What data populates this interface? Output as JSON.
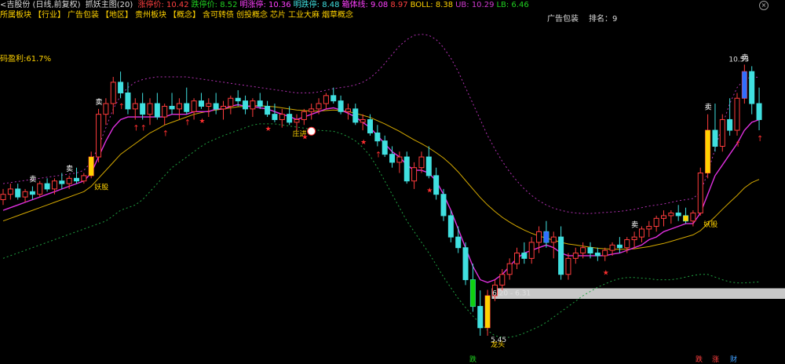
{
  "header": {
    "title": "<吉股份 (日线,前复权)",
    "indicator": "抓妖主图(20)",
    "items": [
      {
        "label": "涨停价: 10.42",
        "color": "#ff4040"
      },
      {
        "label": "跌停价: 8.52",
        "color": "#20d020"
      },
      {
        "label": "明涨停: 10.36",
        "color": "#ff40ff"
      },
      {
        "label": "明跌停: 8.48",
        "color": "#40e0e0"
      },
      {
        "label": "箱体线: 9.08",
        "color": "#ff40ff"
      },
      {
        "label": "8.97",
        "color": "#ff4040"
      },
      {
        "label": "BOLL: 8.38",
        "color": "#ffd200"
      },
      {
        "label": "UB: 10.29",
        "color": "#d03ad0"
      },
      {
        "label": "LB: 6.46",
        "color": "#20d020"
      }
    ]
  },
  "tags": [
    "所属板块",
    "【行业】",
    "广告包装",
    "【地区】",
    "贵州板块",
    "【概念】",
    "含可转债",
    "创投概念",
    "芯片",
    "工业大麻",
    "烟草概念"
  ],
  "ad_label": "广告包装",
  "rank_label": "排名：9",
  "profit_label": "码盈利:61.7%",
  "close_icon": "close-icon",
  "chart_data": {
    "type": "candlestick",
    "candles": [
      [
        8.0,
        8.2,
        7.9,
        8.1
      ],
      [
        8.1,
        8.3,
        8.0,
        8.2
      ],
      [
        8.2,
        8.3,
        8.0,
        8.05
      ],
      [
        8.05,
        8.2,
        7.95,
        8.15
      ],
      [
        8.15,
        8.25,
        8.0,
        8.1
      ],
      [
        8.1,
        8.35,
        8.05,
        8.3
      ],
      [
        8.3,
        8.4,
        8.15,
        8.2
      ],
      [
        8.2,
        8.4,
        8.1,
        8.35
      ],
      [
        8.35,
        8.5,
        8.2,
        8.3
      ],
      [
        8.3,
        8.45,
        8.2,
        8.4
      ],
      [
        8.4,
        8.6,
        8.3,
        8.35
      ],
      [
        8.35,
        8.5,
        8.3,
        8.45
      ],
      [
        8.45,
        8.9,
        8.4,
        8.8
      ],
      [
        8.8,
        9.7,
        8.7,
        9.6
      ],
      [
        9.6,
        9.9,
        9.4,
        9.8
      ],
      [
        9.8,
        10.3,
        9.6,
        10.2
      ],
      [
        10.2,
        10.4,
        9.9,
        10.0
      ],
      [
        10.0,
        10.2,
        9.6,
        9.7
      ],
      [
        9.7,
        9.9,
        9.5,
        9.8
      ],
      [
        9.8,
        10.0,
        9.5,
        9.6
      ],
      [
        9.6,
        9.9,
        9.4,
        9.8
      ],
      [
        9.8,
        10.0,
        9.5,
        9.55
      ],
      [
        9.55,
        9.8,
        9.4,
        9.75
      ],
      [
        9.75,
        10.0,
        9.6,
        9.7
      ],
      [
        9.7,
        9.9,
        9.5,
        9.8
      ],
      [
        9.8,
        10.1,
        9.6,
        9.65
      ],
      [
        9.65,
        9.9,
        9.5,
        9.85
      ],
      [
        9.85,
        10.0,
        9.7,
        9.75
      ],
      [
        9.75,
        9.9,
        9.55,
        9.8
      ],
      [
        9.8,
        10.0,
        9.6,
        9.7
      ],
      [
        9.7,
        9.85,
        9.5,
        9.75
      ],
      [
        9.75,
        9.95,
        9.6,
        9.9
      ],
      [
        9.9,
        10.05,
        9.75,
        9.85
      ],
      [
        9.85,
        9.95,
        9.6,
        9.7
      ],
      [
        9.7,
        9.9,
        9.55,
        9.85
      ],
      [
        9.85,
        10.0,
        9.7,
        9.75
      ],
      [
        9.75,
        9.85,
        9.55,
        9.6
      ],
      [
        9.6,
        9.8,
        9.45,
        9.5
      ],
      [
        9.5,
        9.7,
        9.35,
        9.6
      ],
      [
        9.6,
        9.75,
        9.4,
        9.45
      ],
      [
        9.45,
        9.6,
        9.3,
        9.5
      ],
      [
        9.5,
        9.7,
        9.4,
        9.65
      ],
      [
        9.65,
        9.8,
        9.5,
        9.7
      ],
      [
        9.7,
        9.9,
        9.6,
        9.8
      ],
      [
        9.8,
        10.0,
        9.7,
        9.95
      ],
      [
        9.95,
        10.1,
        9.8,
        9.85
      ],
      [
        9.85,
        9.95,
        9.6,
        9.65
      ],
      [
        9.65,
        9.8,
        9.5,
        9.7
      ],
      [
        9.7,
        9.8,
        9.4,
        9.45
      ],
      [
        9.45,
        9.6,
        9.3,
        9.5
      ],
      [
        9.5,
        9.6,
        9.2,
        9.25
      ],
      [
        9.25,
        9.4,
        9.0,
        9.1
      ],
      [
        9.1,
        9.2,
        8.8,
        8.85
      ],
      [
        8.85,
        9.0,
        8.6,
        8.7
      ],
      [
        8.7,
        8.9,
        8.5,
        8.8
      ],
      [
        8.8,
        8.9,
        8.3,
        8.35
      ],
      [
        8.35,
        8.7,
        8.2,
        8.6
      ],
      [
        8.6,
        8.9,
        8.5,
        8.8
      ],
      [
        8.8,
        9.0,
        8.4,
        8.45
      ],
      [
        8.45,
        8.6,
        8.0,
        8.1
      ],
      [
        8.1,
        8.2,
        7.6,
        7.7
      ],
      [
        7.7,
        7.8,
        7.2,
        7.3
      ],
      [
        7.3,
        7.5,
        7.0,
        7.1
      ],
      [
        7.1,
        7.2,
        6.4,
        6.5
      ],
      [
        6.5,
        6.8,
        5.9,
        6.0
      ],
      [
        6.0,
        6.3,
        5.45,
        5.6
      ],
      [
        5.6,
        6.31,
        5.45,
        6.2
      ],
      [
        6.2,
        6.5,
        6.1,
        6.4
      ],
      [
        6.4,
        6.7,
        6.3,
        6.6
      ],
      [
        6.6,
        6.9,
        6.5,
        6.8
      ],
      [
        6.8,
        7.1,
        6.7,
        7.0
      ],
      [
        7.0,
        7.2,
        6.8,
        6.9
      ],
      [
        6.9,
        7.3,
        6.8,
        7.2
      ],
      [
        7.2,
        7.5,
        7.0,
        7.4
      ],
      [
        7.4,
        7.6,
        7.1,
        7.2
      ],
      [
        7.2,
        7.4,
        6.9,
        7.3
      ],
      [
        7.3,
        7.5,
        6.5,
        6.6
      ],
      [
        6.6,
        7.0,
        6.5,
        6.9
      ],
      [
        6.9,
        7.1,
        6.8,
        7.0
      ],
      [
        7.0,
        7.2,
        6.9,
        7.1
      ],
      [
        7.1,
        7.2,
        6.9,
        7.0
      ],
      [
        7.0,
        7.1,
        6.85,
        6.95
      ],
      [
        6.95,
        7.1,
        6.85,
        7.05
      ],
      [
        7.05,
        7.2,
        6.95,
        7.15
      ],
      [
        7.15,
        7.3,
        7.0,
        7.1
      ],
      [
        7.1,
        7.3,
        7.0,
        7.25
      ],
      [
        7.25,
        7.4,
        7.1,
        7.3
      ],
      [
        7.3,
        7.5,
        7.2,
        7.45
      ],
      [
        7.45,
        7.6,
        7.3,
        7.5
      ],
      [
        7.5,
        7.7,
        7.4,
        7.65
      ],
      [
        7.65,
        7.8,
        7.5,
        7.7
      ],
      [
        7.7,
        7.8,
        7.55,
        7.75
      ],
      [
        7.75,
        7.9,
        7.6,
        7.7
      ],
      [
        7.7,
        7.85,
        7.55,
        7.6
      ],
      [
        7.6,
        7.8,
        7.5,
        7.75
      ],
      [
        7.75,
        8.6,
        7.7,
        8.5
      ],
      [
        8.5,
        9.6,
        8.4,
        9.3
      ],
      [
        9.3,
        9.8,
        8.9,
        9.0
      ],
      [
        9.0,
        9.6,
        8.9,
        9.5
      ],
      [
        9.5,
        9.9,
        9.2,
        9.3
      ],
      [
        9.3,
        10.0,
        9.2,
        9.9
      ],
      [
        9.9,
        10.53,
        9.8,
        10.4
      ],
      [
        10.4,
        10.5,
        9.6,
        9.8
      ],
      [
        9.8,
        10.1,
        9.3,
        9.5
      ]
    ],
    "boll_mid": [
      7.6,
      7.65,
      7.7,
      7.75,
      7.8,
      7.85,
      7.9,
      7.95,
      8.0,
      8.05,
      8.1,
      8.15,
      8.25,
      8.4,
      8.55,
      8.7,
      8.85,
      8.95,
      9.05,
      9.15,
      9.25,
      9.32,
      9.4,
      9.45,
      9.5,
      9.55,
      9.6,
      9.63,
      9.66,
      9.68,
      9.7,
      9.72,
      9.74,
      9.75,
      9.76,
      9.76,
      9.75,
      9.74,
      9.72,
      9.7,
      9.68,
      9.67,
      9.66,
      9.66,
      9.67,
      9.68,
      9.67,
      9.65,
      9.62,
      9.58,
      9.54,
      9.48,
      9.42,
      9.35,
      9.28,
      9.2,
      9.12,
      9.05,
      8.97,
      8.88,
      8.78,
      8.66,
      8.52,
      8.36,
      8.2,
      8.04,
      7.9,
      7.78,
      7.67,
      7.58,
      7.5,
      7.43,
      7.37,
      7.32,
      7.28,
      7.24,
      7.2,
      7.17,
      7.15,
      7.13,
      7.11,
      7.09,
      7.08,
      7.07,
      7.07,
      7.07,
      7.08,
      7.1,
      7.12,
      7.15,
      7.18,
      7.22,
      7.26,
      7.3,
      7.34,
      7.42,
      7.55,
      7.68,
      7.82,
      7.95,
      8.08,
      8.22,
      8.32,
      8.38
    ],
    "support": [
      7.8,
      7.85,
      7.9,
      7.95,
      8.0,
      8.05,
      8.1,
      8.15,
      8.2,
      8.25,
      8.3,
      8.35,
      8.5,
      8.8,
      9.1,
      9.35,
      9.5,
      9.55,
      9.55,
      9.55,
      9.55,
      9.55,
      9.55,
      9.6,
      9.6,
      9.6,
      9.65,
      9.65,
      9.65,
      9.7,
      9.7,
      9.75,
      9.78,
      9.75,
      9.75,
      9.72,
      9.7,
      9.65,
      9.6,
      9.56,
      9.5,
      9.55,
      9.6,
      9.65,
      9.7,
      9.72,
      9.68,
      9.62,
      9.55,
      9.45,
      9.35,
      9.2,
      9.05,
      8.9,
      8.8,
      8.65,
      8.55,
      8.55,
      8.5,
      8.35,
      8.1,
      7.8,
      7.45,
      7.1,
      6.75,
      6.5,
      6.45,
      6.5,
      6.6,
      6.75,
      6.9,
      7.0,
      7.05,
      7.1,
      7.15,
      7.1,
      7.0,
      6.95,
      6.95,
      6.95,
      6.95,
      6.95,
      6.95,
      6.98,
      7.0,
      7.05,
      7.1,
      7.15,
      7.25,
      7.3,
      7.4,
      7.45,
      7.5,
      7.55,
      7.55,
      7.75,
      8.1,
      8.45,
      8.65,
      8.85,
      9.05,
      9.3,
      9.45,
      9.5
    ],
    "ub": [
      8.3,
      8.32,
      8.34,
      8.36,
      8.38,
      8.4,
      8.42,
      8.44,
      8.46,
      8.48,
      8.5,
      8.55,
      8.7,
      9.0,
      9.35,
      9.7,
      9.95,
      10.1,
      10.2,
      10.25,
      10.28,
      10.3,
      10.3,
      10.3,
      10.3,
      10.3,
      10.28,
      10.26,
      10.24,
      10.22,
      10.2,
      10.18,
      10.16,
      10.14,
      10.12,
      10.1,
      10.08,
      10.06,
      10.04,
      10.02,
      10.0,
      10.0,
      10.0,
      10.02,
      10.05,
      10.08,
      10.1,
      10.12,
      10.15,
      10.2,
      10.28,
      10.4,
      10.55,
      10.72,
      10.88,
      11.0,
      11.08,
      11.1,
      11.08,
      11.0,
      10.85,
      10.65,
      10.4,
      10.1,
      9.8,
      9.5,
      9.2,
      8.95,
      8.72,
      8.52,
      8.35,
      8.2,
      8.08,
      7.98,
      7.9,
      7.84,
      7.8,
      7.77,
      7.75,
      7.74,
      7.74,
      7.75,
      7.76,
      7.77,
      7.78,
      7.8,
      7.82,
      7.85,
      7.88,
      7.9,
      7.92,
      7.95,
      7.98,
      8.0,
      8.02,
      8.15,
      8.5,
      8.95,
      9.4,
      9.8,
      10.1,
      10.25,
      10.3,
      10.29
    ],
    "lb": [
      6.9,
      6.95,
      7.0,
      7.05,
      7.1,
      7.15,
      7.2,
      7.25,
      7.3,
      7.35,
      7.4,
      7.45,
      7.5,
      7.55,
      7.6,
      7.7,
      7.8,
      7.85,
      7.9,
      8.0,
      8.15,
      8.3,
      8.45,
      8.6,
      8.7,
      8.8,
      8.9,
      9.0,
      9.08,
      9.14,
      9.2,
      9.25,
      9.3,
      9.35,
      9.4,
      9.42,
      9.42,
      9.42,
      9.4,
      9.38,
      9.36,
      9.34,
      9.32,
      9.3,
      9.29,
      9.28,
      9.24,
      9.18,
      9.1,
      8.98,
      8.82,
      8.6,
      8.35,
      8.1,
      7.85,
      7.6,
      7.4,
      7.2,
      7.0,
      6.78,
      6.55,
      6.35,
      6.15,
      5.98,
      5.82,
      5.68,
      5.55,
      5.45,
      5.42,
      5.42,
      5.45,
      5.5,
      5.56,
      5.62,
      5.7,
      5.8,
      5.9,
      6.0,
      6.1,
      6.2,
      6.28,
      6.36,
      6.42,
      6.48,
      6.52,
      6.54,
      6.54,
      6.53,
      6.52,
      6.5,
      6.5,
      6.5,
      6.52,
      6.55,
      6.58,
      6.6,
      6.6,
      6.55,
      6.5,
      6.46,
      6.44,
      6.44,
      6.45,
      6.46
    ],
    "box_band": [
      6.2,
      6.31
    ],
    "annotations": [
      {
        "text": "卖",
        "i": 13,
        "pos": "above"
      },
      {
        "text": "卖",
        "i": 4,
        "pos": "above"
      },
      {
        "text": "卖",
        "i": 9,
        "pos": "above"
      },
      {
        "text": "卖",
        "i": 86,
        "pos": "above"
      },
      {
        "text": "卖",
        "i": 96,
        "pos": "above"
      },
      {
        "text": "卖",
        "i": 101,
        "pos": "above"
      },
      {
        "text": "妖股",
        "i": 12,
        "pos": "below"
      },
      {
        "text": "妖股",
        "i": 95,
        "pos": "below"
      },
      {
        "text": "庄进",
        "i": 39,
        "pos": "below"
      },
      {
        "text": "龙头",
        "i": 66,
        "pos": "below"
      }
    ],
    "price_labels": [
      "10.53",
      "6.20 - 6.31",
      "5.45"
    ],
    "ylim": [
      5.2,
      11.3
    ]
  },
  "footer": [
    {
      "label": "跌",
      "color": "#20d020",
      "x": 598
    },
    {
      "label": "跌",
      "color": "#ff4040",
      "x": 886
    },
    {
      "label": "涨",
      "color": "#ff4040",
      "x": 907
    },
    {
      "label": "财",
      "color": "#40a0ff",
      "x": 930
    }
  ]
}
